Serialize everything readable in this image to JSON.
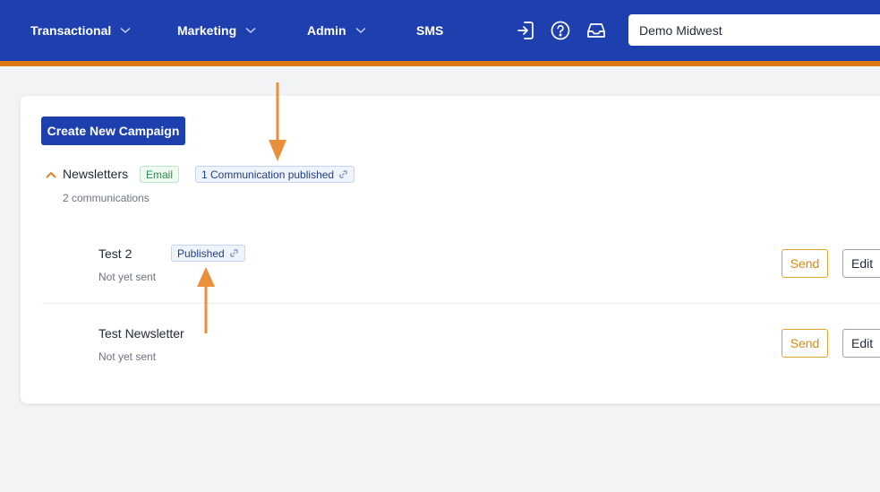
{
  "nav": {
    "items": [
      {
        "label": "Transactional",
        "has_dropdown": true
      },
      {
        "label": "Marketing",
        "has_dropdown": true
      },
      {
        "label": "Admin",
        "has_dropdown": true
      },
      {
        "label": "SMS",
        "has_dropdown": false
      }
    ],
    "icons": [
      "sign-in-icon",
      "help-icon",
      "inbox-icon"
    ],
    "account_select": {
      "value": "Demo Midwest"
    }
  },
  "colors": {
    "topbar": "#1e40af",
    "accent_strip": "#d97a16",
    "annotation_arrow": "#ea8f3a"
  },
  "main": {
    "create_button_label": "Create New Campaign",
    "group": {
      "title": "Newsletters",
      "channel_badge": "Email",
      "published_badge": "1 Communication published",
      "subtitle": "2 communications"
    },
    "rows": [
      {
        "title": "Test 2",
        "badge": "Published",
        "status": "Not yet sent",
        "send_label": "Send",
        "edit_label": "Edit"
      },
      {
        "title": "Test Newsletter",
        "badge": "",
        "status": "Not yet sent",
        "send_label": "Send",
        "edit_label": "Edit"
      }
    ]
  }
}
